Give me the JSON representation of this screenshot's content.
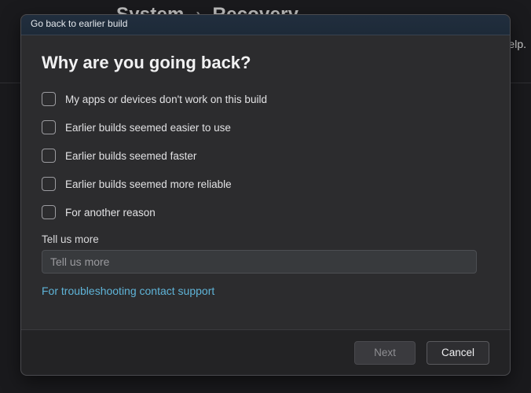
{
  "background": {
    "breadcrumb_parent": "System",
    "breadcrumb_current": "Recovery",
    "help_text": "help."
  },
  "dialog": {
    "title": "Go back to earlier build",
    "heading": "Why are you going back?",
    "options": [
      "My apps or devices don't work on this build",
      "Earlier builds seemed easier to use",
      "Earlier builds seemed faster",
      "Earlier builds seemed more reliable",
      "For another reason"
    ],
    "tell_us_label": "Tell us more",
    "tell_us_placeholder": "Tell us more",
    "support_link": "For troubleshooting contact support",
    "next_label": "Next",
    "cancel_label": "Cancel"
  }
}
